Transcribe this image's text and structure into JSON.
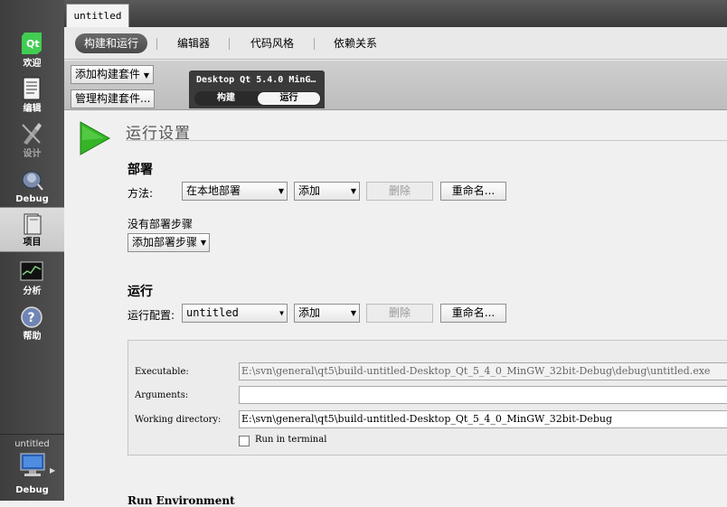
{
  "modebar": {
    "items": [
      {
        "label": "欢迎",
        "icon": "qt-logo-icon"
      },
      {
        "label": "编辑",
        "icon": "edit-document-icon"
      },
      {
        "label": "设计",
        "icon": "design-brush-icon"
      },
      {
        "label": "Debug",
        "icon": "debug-bug-icon"
      },
      {
        "label": "项目",
        "icon": "project-folder-icon",
        "active": true
      },
      {
        "label": "分析",
        "icon": "analyze-chart-icon"
      },
      {
        "label": "帮助",
        "icon": "help-icon"
      }
    ],
    "target": {
      "project": "untitled",
      "mode": "Debug",
      "icon": "computer-icon"
    }
  },
  "document_tab": "untitled",
  "subtabs": [
    "构建和运行",
    "编辑器",
    "代码风格",
    "依赖关系"
  ],
  "kitbar": {
    "add_kit": "添加构建套件",
    "manage_kits": "管理构建套件...",
    "kit_name": "Desktop Qt 5.4.0 MinG…",
    "build": "构建",
    "run": "运行"
  },
  "run_settings": {
    "title": "运行设置",
    "deploy": {
      "heading": "部署",
      "method_label": "方法:",
      "method_value": "在本地部署",
      "add": "添加",
      "remove": "删除",
      "rename": "重命名...",
      "no_steps": "没有部署步骤",
      "add_step": "添加部署步骤"
    },
    "run": {
      "heading": "运行",
      "config_label": "运行配置:",
      "config_value": "untitled",
      "add": "添加",
      "remove": "删除",
      "rename": "重命名...",
      "executable_label": "Executable:",
      "executable_value": "E:\\svn\\general\\qt5\\build-untitled-Desktop_Qt_5_4_0_MinGW_32bit-Debug\\debug\\untitled.exe",
      "arguments_label": "Arguments:",
      "arguments_value": "",
      "workdir_label": "Working directory:",
      "workdir_value": "E:\\svn\\general\\qt5\\build-untitled-Desktop_Qt_5_4_0_MinGW_32bit-Debug",
      "run_in_terminal": "Run in terminal",
      "run_in_terminal_checked": false
    },
    "run_environment": "Run Environment"
  }
}
